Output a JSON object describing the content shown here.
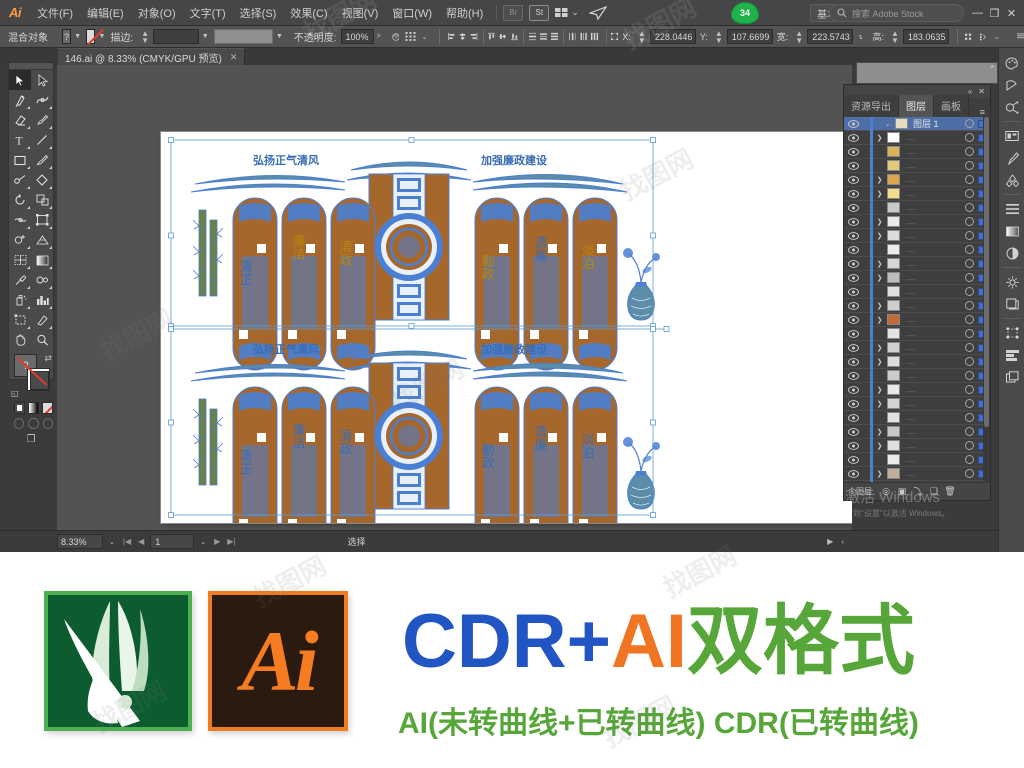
{
  "app": {
    "logo": "Ai",
    "title_badge": "34",
    "workspace": "基本功能",
    "search_placeholder": "搜索 Adobe Stock",
    "search_icon": "search-icon"
  },
  "menu": {
    "items": [
      {
        "label": "文件(F)"
      },
      {
        "label": "编辑(E)"
      },
      {
        "label": "对象(O)"
      },
      {
        "label": "文字(T)"
      },
      {
        "label": "选择(S)"
      },
      {
        "label": "效果(C)"
      },
      {
        "label": "视图(V)"
      },
      {
        "label": "窗口(W)"
      },
      {
        "label": "帮助(H)"
      }
    ],
    "bridge_button": "Br",
    "stock_button": "St"
  },
  "window_controls": {
    "minimize": "—",
    "restore": "❐",
    "close": "✕"
  },
  "control_bar": {
    "selection_label": "混合对象",
    "fill_value": "?",
    "stroke_value": "无",
    "stroke_label": "描边:",
    "stroke_weight": "",
    "profile": "",
    "opacity_label": "不透明度:",
    "opacity_value": "100%",
    "opacity_arrow": ">",
    "x_label": "X:",
    "x_value": "228.0446",
    "y_label": "Y:",
    "y_value": "107.6699",
    "w_label": "宽:",
    "w_value": "223.5743",
    "h_label": "高:",
    "h_value": "183.0635",
    "link_icon": "link-icon",
    "align_icons": [
      "align-left",
      "align-center-h",
      "align-right",
      "align-top",
      "align-middle-v",
      "align-bottom",
      "distribute-top",
      "distribute-center-v",
      "distribute-bottom",
      "distribute-left",
      "distribute-center-h",
      "distribute-right"
    ],
    "transform_icon": "transform-icon",
    "more_options_icon": "more-options-icon"
  },
  "document_tab": {
    "label": "146.ai @ 8.33% (CMYK/GPU 预览)",
    "close": "✕"
  },
  "toolbox": {
    "tools": [
      {
        "name": "selection-tool",
        "active": true
      },
      {
        "name": "direct-selection-tool",
        "active": false
      },
      {
        "name": "magic-wand-tool",
        "active": false
      },
      {
        "name": "lasso-tool",
        "active": false
      },
      {
        "name": "pen-tool",
        "active": false
      },
      {
        "name": "curvature-tool",
        "active": false
      },
      {
        "name": "type-tool",
        "active": false
      },
      {
        "name": "line-segment-tool",
        "active": false
      },
      {
        "name": "rectangle-tool",
        "active": false
      },
      {
        "name": "paintbrush-tool",
        "active": false
      },
      {
        "name": "shaper-tool",
        "active": false
      },
      {
        "name": "eraser-tool",
        "active": false
      },
      {
        "name": "rotate-tool",
        "active": false
      },
      {
        "name": "scale-tool",
        "active": false
      },
      {
        "name": "width-tool",
        "active": false
      },
      {
        "name": "free-transform-tool",
        "active": false
      },
      {
        "name": "shape-builder-tool",
        "active": false
      },
      {
        "name": "perspective-grid-tool",
        "active": false
      },
      {
        "name": "mesh-tool",
        "active": false
      },
      {
        "name": "gradient-tool",
        "active": false
      },
      {
        "name": "eyedropper-tool",
        "active": false
      },
      {
        "name": "blend-tool",
        "active": false
      },
      {
        "name": "symbol-sprayer-tool",
        "active": false
      },
      {
        "name": "column-graph-tool",
        "active": false
      },
      {
        "name": "artboard-tool",
        "active": false
      },
      {
        "name": "slice-tool",
        "active": false
      },
      {
        "name": "hand-tool",
        "active": false
      },
      {
        "name": "zoom-tool",
        "active": false
      }
    ],
    "fill_label": "?",
    "stroke_label": "无",
    "swap_icon": "swap-fill-stroke-icon",
    "default_icon": "default-fill-stroke-icon",
    "color_modes": [
      "color-mode",
      "gradient-mode",
      "none-mode"
    ],
    "screen_mode_icon": "screen-mode-icon"
  },
  "panels": {
    "tabs": [
      {
        "label": "资源导出",
        "active": false
      },
      {
        "label": "图层",
        "active": true
      },
      {
        "label": "画板",
        "active": false
      }
    ],
    "menu_icon": "panel-menu-icon",
    "collapse_icon": "collapse-panel-icon",
    "close_icon": "close-panel-icon",
    "layers": [
      {
        "name": "图层 1",
        "selected": true,
        "expandable": true,
        "expanded": true,
        "thumb": "#e7dcc0"
      },
      {
        "name": "",
        "selected": false,
        "expandable": true,
        "thumb": "#ffffff"
      },
      {
        "name": "",
        "selected": false,
        "expandable": false,
        "thumb": "#d7b45a"
      },
      {
        "name": "",
        "selected": false,
        "expandable": false,
        "thumb": "#e3c97a"
      },
      {
        "name": "",
        "selected": false,
        "expandable": true,
        "thumb": "#d9a64d"
      },
      {
        "name": "",
        "selected": false,
        "expandable": true,
        "thumb": "#f2dd8e"
      },
      {
        "name": "",
        "selected": false,
        "expandable": false,
        "thumb": "#c9c9c9"
      },
      {
        "name": "",
        "selected": false,
        "expandable": true,
        "thumb": "#e9e9e9"
      },
      {
        "name": "",
        "selected": false,
        "expandable": true,
        "thumb": "#dcdcdc"
      },
      {
        "name": "",
        "selected": false,
        "expandable": false,
        "thumb": "#ededed"
      },
      {
        "name": "",
        "selected": false,
        "expandable": true,
        "thumb": "#d6d6d6"
      },
      {
        "name": "",
        "selected": false,
        "expandable": true,
        "thumb": "#bdbdbd"
      },
      {
        "name": "",
        "selected": false,
        "expandable": false,
        "thumb": "#e0e0e0"
      },
      {
        "name": "",
        "selected": false,
        "expandable": true,
        "thumb": "#cfcfcf"
      },
      {
        "name": "",
        "selected": false,
        "expandable": true,
        "thumb": "#c06a34"
      },
      {
        "name": "",
        "selected": false,
        "expandable": false,
        "thumb": "#e4e4e4"
      },
      {
        "name": "",
        "selected": false,
        "expandable": true,
        "thumb": "#d0d0d0"
      },
      {
        "name": "",
        "selected": false,
        "expandable": true,
        "thumb": "#dddddd"
      },
      {
        "name": "",
        "selected": false,
        "expandable": false,
        "thumb": "#cccccc"
      },
      {
        "name": "",
        "selected": false,
        "expandable": true,
        "thumb": "#e8e8e8"
      },
      {
        "name": "",
        "selected": false,
        "expandable": true,
        "thumb": "#d4d4d4"
      },
      {
        "name": "",
        "selected": false,
        "expandable": false,
        "thumb": "#e2e2e2"
      },
      {
        "name": "",
        "selected": false,
        "expandable": true,
        "thumb": "#c7c7c7"
      },
      {
        "name": "",
        "selected": false,
        "expandable": true,
        "thumb": "#dedede"
      },
      {
        "name": "",
        "selected": false,
        "expandable": false,
        "thumb": "#ebebeb"
      },
      {
        "name": "",
        "selected": false,
        "expandable": true,
        "thumb": "#bfae9a"
      },
      {
        "name": "",
        "selected": false,
        "expandable": true,
        "thumb": "#d8d8d8"
      },
      {
        "name": "",
        "selected": false,
        "expandable": false,
        "thumb": "#e6e6e6"
      },
      {
        "name": "",
        "selected": false,
        "expandable": true,
        "thumb": "#cdcdcd"
      },
      {
        "name": "",
        "selected": false,
        "expandable": true,
        "thumb": "#ffffff"
      },
      {
        "name": "",
        "selected": false,
        "expandable": true,
        "thumb": "#b5631f"
      }
    ],
    "footer": {
      "count_label": "个图层",
      "icons": [
        "locate-object-icon",
        "make-clipping-mask-icon",
        "create-sublayer-icon",
        "new-layer-icon",
        "delete-layer-icon"
      ]
    },
    "dock_icons": [
      "color-panel-icon",
      "color-guide-icon",
      "symbols-panel-icon",
      "libraries-panel-icon",
      "brushes-panel-icon",
      "swatches-panel-icon",
      "align-panel-icon",
      "gradient-panel-icon",
      "transparency-panel-icon",
      "appearance-panel-icon",
      "graphic-styles-panel-icon",
      "transform-panel-icon",
      "pathfinder-panel-icon",
      "stroke-panel-icon",
      "layers-dock-icon"
    ]
  },
  "status_bar": {
    "zoom": "8.33%",
    "page": "1",
    "status_text": "选择",
    "first_icon": "first-page-icon",
    "prev_icon": "prev-page-icon",
    "next_icon": "next-page-icon",
    "last_icon": "last-page-icon"
  },
  "artwork": {
    "top_title_left": "弘扬正气清风",
    "top_title_right": "加强廉政建设",
    "panel_words_left": [
      "清正",
      "廉洁",
      "清政"
    ],
    "panel_words_right": [
      "勤政",
      "清廉",
      "淡泊"
    ],
    "colors": {
      "wood": "#a5672c",
      "blue": "#4a7fd4",
      "teal": "#5b8ca8",
      "bamboo_green": "#6b7f4a"
    }
  },
  "os_watermark": {
    "line1": "激活 Windows",
    "line2": "转到\"设置\"以激活 Windows。"
  },
  "site_watermark": "找图网",
  "banner": {
    "logos": [
      {
        "name": "coreldraw-logo",
        "label": ""
      },
      {
        "name": "illustrator-logo",
        "label": "Ai"
      }
    ],
    "title_parts": [
      {
        "text": "CDR",
        "color": "#2255c4"
      },
      {
        "text": "+",
        "color": "#2255c4"
      },
      {
        "text": "AI",
        "color": "#ef7522"
      },
      {
        "text": "双格式",
        "color": "#57a639"
      }
    ],
    "subtitle": "AI(未转曲线+已转曲线) CDR(已转曲线)"
  }
}
